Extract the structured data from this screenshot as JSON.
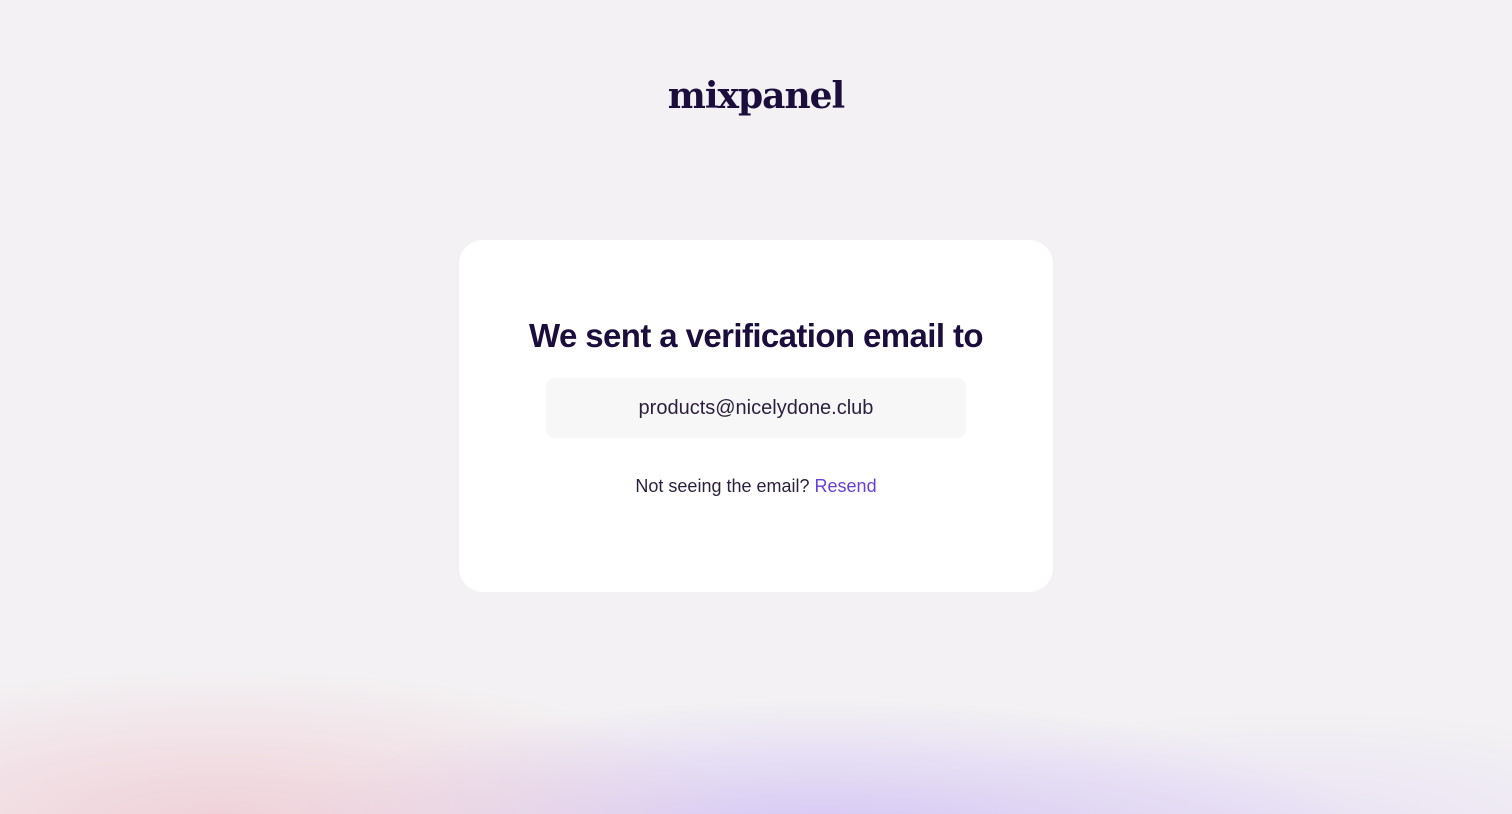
{
  "logo": {
    "text": "mixpanel"
  },
  "verification": {
    "heading": "We sent a verification email to",
    "email": "products@nicelydone.club",
    "prompt_text": "Not seeing the email?",
    "resend_label": "Resend"
  },
  "colors": {
    "text_primary": "#1b0e3d",
    "link": "#6a3ed8",
    "background": "#f3f1f3",
    "card": "#ffffff"
  }
}
